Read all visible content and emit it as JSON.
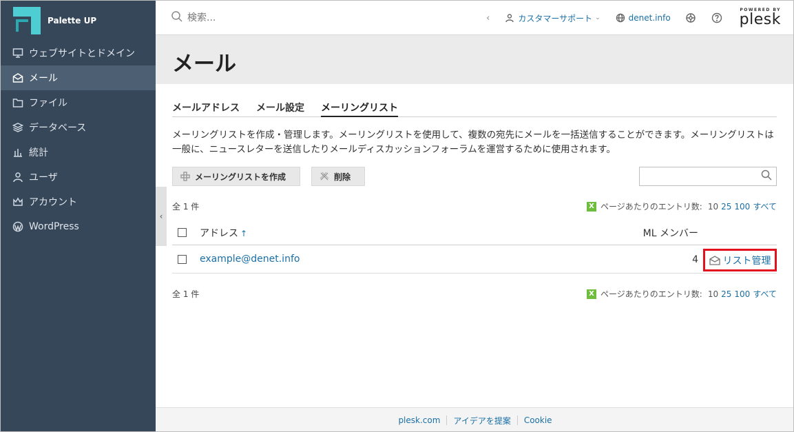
{
  "brand": {
    "name": "Palette UP"
  },
  "sidebar": {
    "items": [
      {
        "label": "ウェブサイトとドメイン",
        "icon": "monitor-icon",
        "active": false
      },
      {
        "label": "メール",
        "icon": "mail-icon",
        "active": true
      },
      {
        "label": "ファイル",
        "icon": "folder-icon",
        "active": false
      },
      {
        "label": "データベース",
        "icon": "database-icon",
        "active": false
      },
      {
        "label": "統計",
        "icon": "bar-chart-icon",
        "active": false
      },
      {
        "label": "ユーザ",
        "icon": "user-icon",
        "active": false
      },
      {
        "label": "アカウント",
        "icon": "crown-icon",
        "active": false
      },
      {
        "label": "WordPress",
        "icon": "wordpress-icon",
        "active": false
      }
    ]
  },
  "header": {
    "search_placeholder": "検索...",
    "user_label": "カスタマーサポート",
    "domain_label": "denet.info",
    "powered_by": "POWERED BY",
    "plesk": "plesk"
  },
  "page": {
    "title": "メール"
  },
  "tabs": [
    {
      "label": "メールアドレス",
      "active": false
    },
    {
      "label": "メール設定",
      "active": false
    },
    {
      "label": "メーリングリスト",
      "active": true
    }
  ],
  "description": "メーリングリストを作成・管理します。メーリングリストを使用して、複数の宛先にメールを一括送信することができます。メーリングリストは一般に、ニュースレターを送信したりメールディスカッションフォーラムを運営するために使用されます。",
  "toolbar": {
    "create_label": "メーリングリストを作成",
    "delete_label": "削除"
  },
  "list": {
    "total_label": "全 1 件",
    "per_page_label": "ページあたりのエントリ数:",
    "per_page_options": [
      "10",
      "25",
      "100",
      "すべて"
    ],
    "columns": {
      "address": "アドレス",
      "sort_indicator": "↑",
      "members": "ML メンバー"
    },
    "rows": [
      {
        "address": "example@denet.info",
        "members": "4",
        "action": "リスト管理"
      }
    ]
  },
  "footer": {
    "links": [
      "plesk.com",
      "アイデアを提案",
      "Cookie"
    ]
  },
  "colors": {
    "sidebar_bg": "#37475a",
    "sidebar_active": "#4d5f73",
    "link": "#1a6fa5",
    "highlight_border": "#e3101e",
    "brand_logo": "#3dc1c6"
  }
}
